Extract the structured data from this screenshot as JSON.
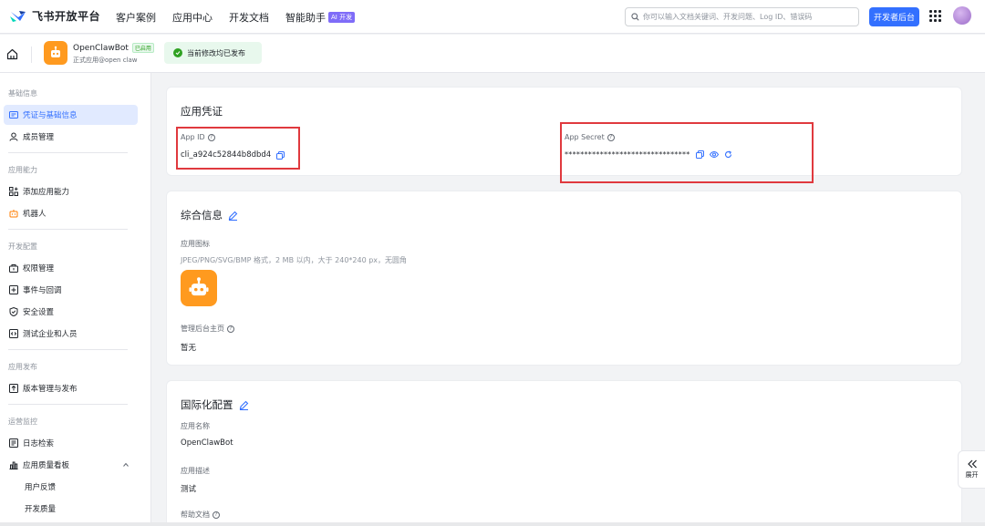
{
  "topbar": {
    "logo_text": "飞书开放平台",
    "nav": [
      "客户案例",
      "应用中心",
      "开发文档",
      "智能助手"
    ],
    "ai_badge": "AI 开发",
    "search_placeholder": "你可以输入文档关键词、开发问题、Log ID、错误码",
    "dev_button": "开发者后台"
  },
  "app_header": {
    "name": "OpenClawBot",
    "status_tag": "已启用",
    "subtitle": "正式应用@open claw",
    "publish_status": "当前修改均已发布"
  },
  "sidebar": {
    "groups": [
      {
        "title": "基础信息",
        "items": [
          {
            "label": "凭证与基础信息",
            "icon": "id-card-icon",
            "active": true
          },
          {
            "label": "成员管理",
            "icon": "user-icon"
          }
        ]
      },
      {
        "title": "应用能力",
        "items": [
          {
            "label": "添加应用能力",
            "icon": "grid-add-icon"
          },
          {
            "label": "机器人",
            "icon": "robot-icon"
          }
        ]
      },
      {
        "title": "开发配置",
        "items": [
          {
            "label": "权限管理",
            "icon": "key-icon"
          },
          {
            "label": "事件与回调",
            "icon": "event-icon"
          },
          {
            "label": "安全设置",
            "icon": "shield-icon"
          },
          {
            "label": "测试企业和人员",
            "icon": "code-icon"
          }
        ]
      },
      {
        "title": "应用发布",
        "items": [
          {
            "label": "版本管理与发布",
            "icon": "upload-icon"
          }
        ]
      },
      {
        "title": "运营监控",
        "items": [
          {
            "label": "日志检索",
            "icon": "log-icon"
          },
          {
            "label": "应用质量看板",
            "icon": "chart-icon"
          },
          {
            "label": "用户反馈",
            "sub": true
          },
          {
            "label": "开发质量",
            "sub": true
          }
        ]
      }
    ]
  },
  "credentials": {
    "title": "应用凭证",
    "app_id_label": "App ID",
    "app_id_value": "cli_a924c52844b8dbd4",
    "app_secret_label": "App Secret",
    "app_secret_value": "********************************"
  },
  "general": {
    "title": "综合信息",
    "icon_label": "应用图标",
    "icon_hint": "JPEG/PNG/SVG/BMP 格式，2 MB 以内，大于 240*240 px，无圆角",
    "admin_label": "管理后台主页",
    "admin_value": "暂无"
  },
  "i18n": {
    "title": "国际化配置",
    "name_label": "应用名称",
    "name_value": "OpenClawBot",
    "desc_label": "应用描述",
    "desc_value": "测试",
    "help_label": "帮助文档"
  },
  "expand_label": "展开",
  "colors": {
    "brand": "#3370ff",
    "app_icon": "#ff9a1f",
    "highlight_box": "#e0393e",
    "success": "#2ea121"
  }
}
